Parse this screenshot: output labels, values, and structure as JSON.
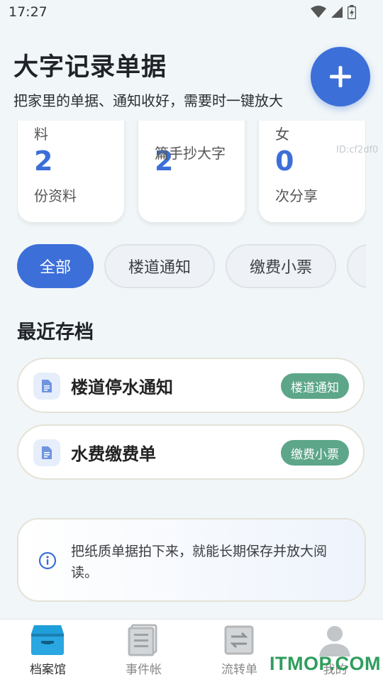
{
  "status_bar": {
    "time": "17:27"
  },
  "header": {
    "title": "大字记录单据",
    "subtitle": "把家里的单据、通知收好，需要时一键放大"
  },
  "stats": [
    {
      "fragment": "料",
      "value": "2",
      "label": "份资料"
    },
    {
      "fragment": "",
      "value": "2",
      "label": "篇手抄大字"
    },
    {
      "fragment": "女",
      "value": "0",
      "label": "次分享"
    }
  ],
  "id_watermark": "ID:cf2df0",
  "filters": [
    {
      "label": "全部",
      "active": true
    },
    {
      "label": "楼道通知",
      "active": false
    },
    {
      "label": "缴费小票",
      "active": false
    }
  ],
  "recent": {
    "title": "最近存档",
    "items": [
      {
        "title": "楼道停水通知",
        "tag": "楼道通知"
      },
      {
        "title": "水费缴费单",
        "tag": "缴费小票"
      }
    ]
  },
  "tip": {
    "text": "把纸质单据拍下来，就能长期保存并放大阅读。"
  },
  "nav": [
    {
      "label": "档案馆",
      "icon": "archive-box-icon",
      "active": true
    },
    {
      "label": "事件帐",
      "icon": "ledger-icon",
      "active": false
    },
    {
      "label": "流转单",
      "icon": "swap-icon",
      "active": false
    },
    {
      "label": "我的",
      "icon": "user-icon",
      "active": false
    }
  ],
  "watermark": "ITMOP.COM",
  "colors": {
    "accent": "#3c6fd8",
    "tag": "#5da68a",
    "background": "#f1f6f8"
  }
}
